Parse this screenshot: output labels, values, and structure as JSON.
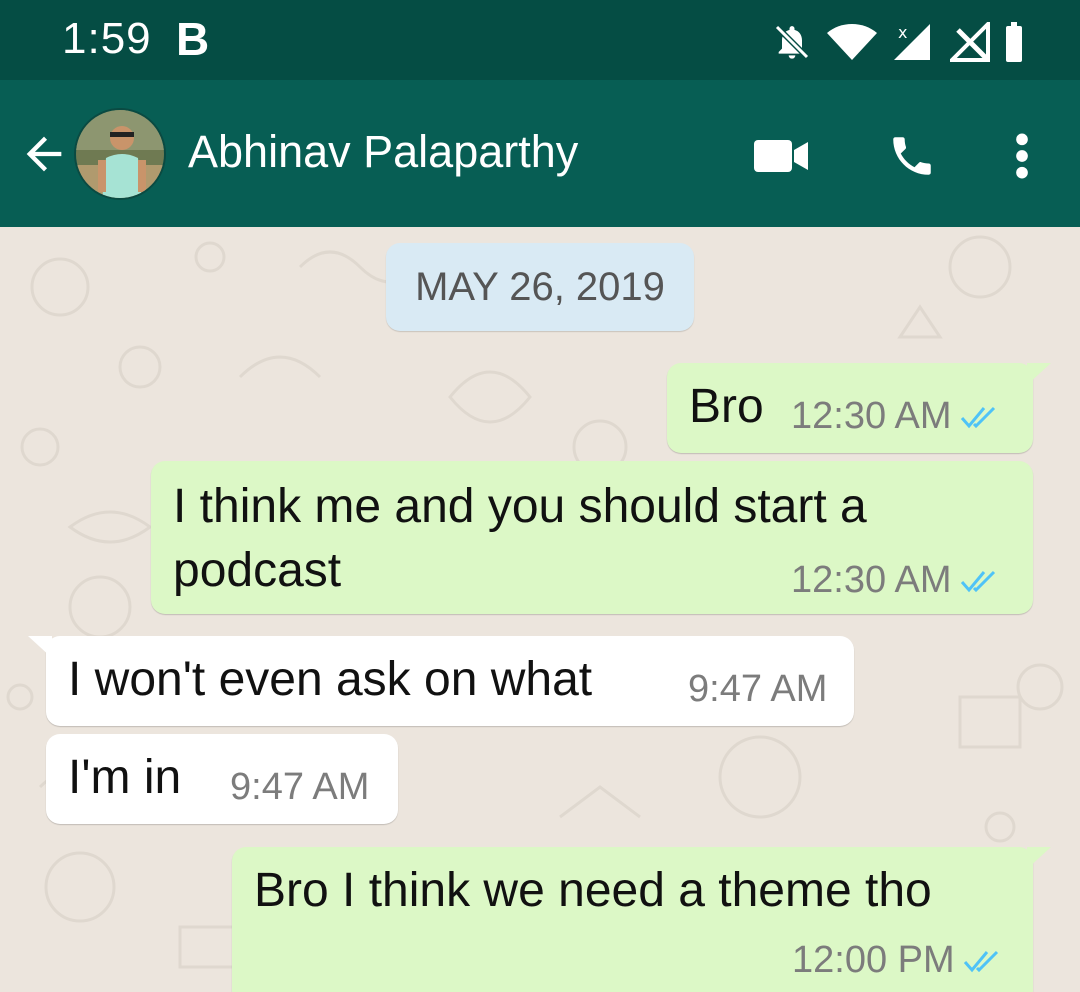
{
  "status_bar": {
    "time": "1:59",
    "app_badge": "B",
    "icons": [
      "bell-off-icon",
      "wifi-icon",
      "signal-icon",
      "no-signal-icon",
      "battery-icon"
    ]
  },
  "header": {
    "back_icon": "back-arrow-icon",
    "contact_name": "Abhinav Palaparthy",
    "actions": [
      "video-call-icon",
      "phone-icon",
      "more-vert-icon"
    ]
  },
  "chat": {
    "date": "MAY 26, 2019",
    "messages": [
      {
        "direction": "outgoing",
        "text": "Bro",
        "time": "12:30 AM",
        "read": true
      },
      {
        "direction": "outgoing",
        "line1": "I think me and you should start a",
        "line2": "podcast",
        "time": "12:30 AM",
        "read": true
      },
      {
        "direction": "incoming",
        "text": "I won't even ask on what",
        "time": "9:47 AM"
      },
      {
        "direction": "incoming",
        "text": "I'm in",
        "time": "9:47 AM"
      },
      {
        "direction": "outgoing",
        "text": "Bro I think we need a theme tho",
        "time": "12:00 PM",
        "read": true
      }
    ]
  },
  "colors": {
    "status_bar": "#054d44",
    "header": "#075e54",
    "outgoing_bubble": "#dcf8c6",
    "incoming_bubble": "#ffffff",
    "read_tick": "#4fc3f7",
    "background": "#ece5dd"
  }
}
